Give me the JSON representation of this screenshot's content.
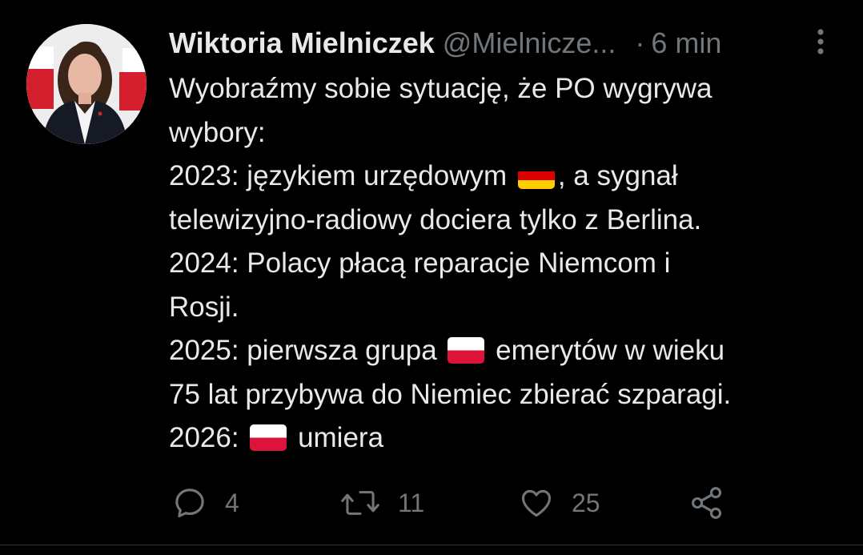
{
  "author": {
    "display_name": "Wiktoria Mielniczek",
    "handle": "@Mielnicze...",
    "separator": "·",
    "time": "6 min"
  },
  "tweet": {
    "segments": {
      "l1": "Wyobraźmy sobie sytuację, że PO wygrywa",
      "l2": "wybory:",
      "l3a": "2023: językiem urzędowym",
      "l3b": ", a sygnał",
      "l4": "telewizyjno-radiowy dociera tylko z Berlina.",
      "l5": "2024: Polacy płacą reparacje Niemcom i",
      "l6": "Rosji.",
      "l7a": "2025: pierwsza grupa",
      "l7b": "emerytów w wieku",
      "l8": "75 lat przybywa do Niemiec zbierać szparagi.",
      "l9a": "2026:",
      "l9b": "umiera"
    },
    "emojis": [
      "flag-germany",
      "flag-poland",
      "flag-poland"
    ]
  },
  "actions": {
    "reply_count": "4",
    "retweet_count": "11",
    "like_count": "25"
  },
  "icons": {
    "more": "more-vertical-icon",
    "reply": "reply-icon",
    "retweet": "retweet-icon",
    "like": "heart-icon",
    "share": "share-icon"
  },
  "colors": {
    "background": "#000000",
    "text": "#e7e9ea",
    "secondary": "#71767b"
  }
}
